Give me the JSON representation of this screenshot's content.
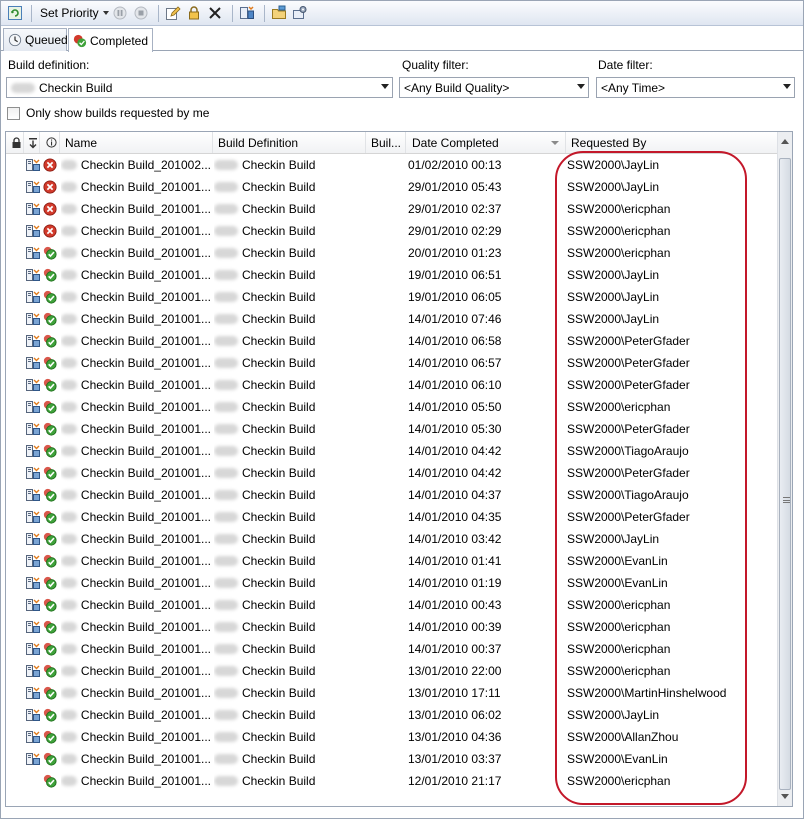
{
  "toolbar": {
    "set_priority_label": "Set Priority",
    "icons": [
      "refresh-icon",
      "pause-icon",
      "stop-icon",
      "edit-icon",
      "lock-icon",
      "delete-icon",
      "build-icon",
      "open-folder-icon",
      "settings-icon"
    ]
  },
  "tabs": [
    {
      "label": "Queued",
      "active": false
    },
    {
      "label": "Completed",
      "active": true
    }
  ],
  "filters": {
    "build_definition_label": "Build definition:",
    "build_definition_value": "Checkin Build",
    "quality_label": "Quality filter:",
    "quality_value": "<Any Build Quality>",
    "date_label": "Date filter:",
    "date_value": "<Any Time>",
    "only_mine_label": "Only show builds requested by me",
    "only_mine_checked": false
  },
  "columns": {
    "name": "Name",
    "build_definition": "Build Definition",
    "build_agent": "Buil...",
    "date_completed": "Date Completed",
    "requested_by": "Requested By"
  },
  "colors": {
    "failed": "#d23a2b",
    "succeeded": "#3fa23a",
    "annotation": "#c3182a"
  },
  "rows": [
    {
      "status": "failed",
      "name": "Checkin Build_201002...",
      "definition": "Checkin Build",
      "date": "01/02/2010 00:13",
      "requested": "SSW2000\\JayLin"
    },
    {
      "status": "failed",
      "name": "Checkin Build_201001...",
      "definition": "Checkin Build",
      "date": "29/01/2010 05:43",
      "requested": "SSW2000\\JayLin"
    },
    {
      "status": "failed",
      "name": "Checkin Build_201001...",
      "definition": "Checkin Build",
      "date": "29/01/2010 02:37",
      "requested": "SSW2000\\ericphan"
    },
    {
      "status": "failed",
      "name": "Checkin Build_201001...",
      "definition": "Checkin Build",
      "date": "29/01/2010 02:29",
      "requested": "SSW2000\\ericphan"
    },
    {
      "status": "succeeded",
      "name": "Checkin Build_201001...",
      "definition": "Checkin Build",
      "date": "20/01/2010 01:23",
      "requested": "SSW2000\\ericphan"
    },
    {
      "status": "succeeded",
      "name": "Checkin Build_201001...",
      "definition": "Checkin Build",
      "date": "19/01/2010 06:51",
      "requested": "SSW2000\\JayLin"
    },
    {
      "status": "succeeded",
      "name": "Checkin Build_201001...",
      "definition": "Checkin Build",
      "date": "19/01/2010 06:05",
      "requested": "SSW2000\\JayLin"
    },
    {
      "status": "succeeded",
      "name": "Checkin Build_201001...",
      "definition": "Checkin Build",
      "date": "14/01/2010 07:46",
      "requested": "SSW2000\\JayLin"
    },
    {
      "status": "succeeded",
      "name": "Checkin Build_201001...",
      "definition": "Checkin Build",
      "date": "14/01/2010 06:58",
      "requested": "SSW2000\\PeterGfader"
    },
    {
      "status": "succeeded",
      "name": "Checkin Build_201001...",
      "definition": "Checkin Build",
      "date": "14/01/2010 06:57",
      "requested": "SSW2000\\PeterGfader"
    },
    {
      "status": "succeeded",
      "name": "Checkin Build_201001...",
      "definition": "Checkin Build",
      "date": "14/01/2010 06:10",
      "requested": "SSW2000\\PeterGfader"
    },
    {
      "status": "succeeded",
      "name": "Checkin Build_201001...",
      "definition": "Checkin Build",
      "date": "14/01/2010 05:50",
      "requested": "SSW2000\\ericphan"
    },
    {
      "status": "succeeded",
      "name": "Checkin Build_201001...",
      "definition": "Checkin Build",
      "date": "14/01/2010 05:30",
      "requested": "SSW2000\\PeterGfader"
    },
    {
      "status": "succeeded",
      "name": "Checkin Build_201001...",
      "definition": "Checkin Build",
      "date": "14/01/2010 04:42",
      "requested": "SSW2000\\TiagoAraujo"
    },
    {
      "status": "succeeded",
      "name": "Checkin Build_201001...",
      "definition": "Checkin Build",
      "date": "14/01/2010 04:42",
      "requested": "SSW2000\\PeterGfader"
    },
    {
      "status": "succeeded",
      "name": "Checkin Build_201001...",
      "definition": "Checkin Build",
      "date": "14/01/2010 04:37",
      "requested": "SSW2000\\TiagoAraujo"
    },
    {
      "status": "succeeded",
      "name": "Checkin Build_201001...",
      "definition": "Checkin Build",
      "date": "14/01/2010 04:35",
      "requested": "SSW2000\\PeterGfader"
    },
    {
      "status": "succeeded",
      "name": "Checkin Build_201001...",
      "definition": "Checkin Build",
      "date": "14/01/2010 03:42",
      "requested": "SSW2000\\JayLin"
    },
    {
      "status": "succeeded",
      "name": "Checkin Build_201001...",
      "definition": "Checkin Build",
      "date": "14/01/2010 01:41",
      "requested": "SSW2000\\EvanLin"
    },
    {
      "status": "succeeded",
      "name": "Checkin Build_201001...",
      "definition": "Checkin Build",
      "date": "14/01/2010 01:19",
      "requested": "SSW2000\\EvanLin"
    },
    {
      "status": "succeeded",
      "name": "Checkin Build_201001...",
      "definition": "Checkin Build",
      "date": "14/01/2010 00:43",
      "requested": "SSW2000\\ericphan"
    },
    {
      "status": "succeeded",
      "name": "Checkin Build_201001...",
      "definition": "Checkin Build",
      "date": "14/01/2010 00:39",
      "requested": "SSW2000\\ericphan"
    },
    {
      "status": "succeeded",
      "name": "Checkin Build_201001...",
      "definition": "Checkin Build",
      "date": "14/01/2010 00:37",
      "requested": "SSW2000\\ericphan"
    },
    {
      "status": "succeeded",
      "name": "Checkin Build_201001...",
      "definition": "Checkin Build",
      "date": "13/01/2010 22:00",
      "requested": "SSW2000\\ericphan"
    },
    {
      "status": "succeeded",
      "name": "Checkin Build_201001...",
      "definition": "Checkin Build",
      "date": "13/01/2010 17:11",
      "requested": "SSW2000\\MartinHinshelwood"
    },
    {
      "status": "succeeded",
      "name": "Checkin Build_201001...",
      "definition": "Checkin Build",
      "date": "13/01/2010 06:02",
      "requested": "SSW2000\\JayLin"
    },
    {
      "status": "succeeded",
      "name": "Checkin Build_201001...",
      "definition": "Checkin Build",
      "date": "13/01/2010 04:36",
      "requested": "SSW2000\\AllanZhou"
    },
    {
      "status": "succeeded",
      "name": "Checkin Build_201001...",
      "definition": "Checkin Build",
      "date": "13/01/2010 03:37",
      "requested": "SSW2000\\EvanLin"
    },
    {
      "status": "succeeded",
      "name": "Checkin Build_201001...",
      "definition": "Checkin Build",
      "date": "12/01/2010 21:17",
      "requested": "SSW2000\\ericphan",
      "no_retain": true
    }
  ]
}
